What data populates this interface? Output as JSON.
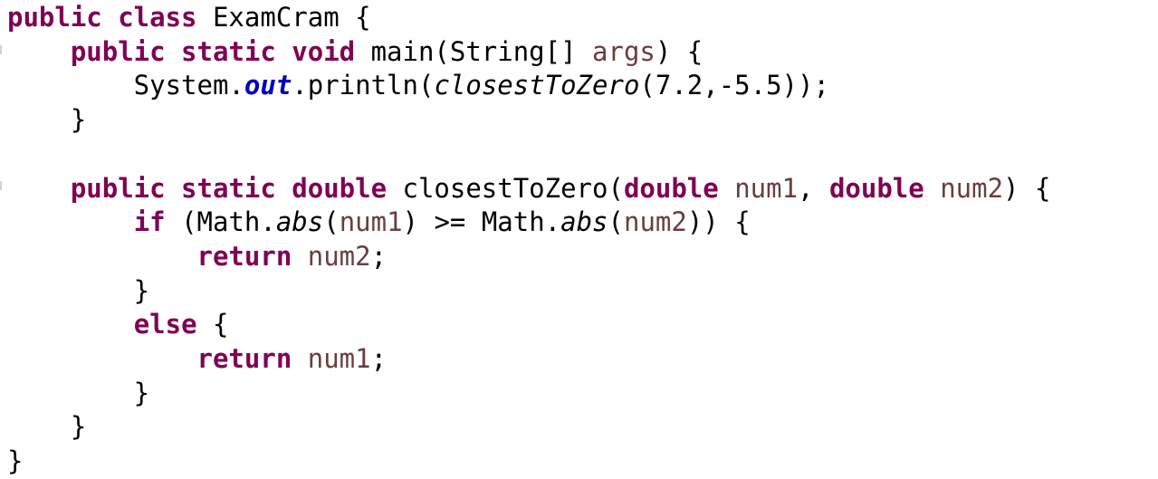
{
  "editor": {
    "lines": [
      {
        "tokens": [
          {
            "t": "public class",
            "k": "kw"
          },
          {
            "t": " ExamCram {",
            "k": "plain"
          }
        ]
      },
      {
        "tokens": [
          {
            "t": "    ",
            "k": "plain"
          },
          {
            "t": "public static void",
            "k": "kw"
          },
          {
            "t": " main(String[] ",
            "k": "plain"
          },
          {
            "t": "args",
            "k": "var"
          },
          {
            "t": ") {",
            "k": "plain"
          }
        ]
      },
      {
        "tokens": [
          {
            "t": "        System.",
            "k": "plain"
          },
          {
            "t": "out",
            "k": "fld"
          },
          {
            "t": ".println(",
            "k": "plain"
          },
          {
            "t": "closestToZero",
            "k": "stc"
          },
          {
            "t": "(7.2,-5.5));",
            "k": "plain"
          }
        ]
      },
      {
        "tokens": [
          {
            "t": "    }",
            "k": "plain"
          }
        ]
      },
      {
        "tokens": []
      },
      {
        "tokens": [
          {
            "t": "    ",
            "k": "plain"
          },
          {
            "t": "public static double",
            "k": "kw"
          },
          {
            "t": " closestToZero(",
            "k": "plain"
          },
          {
            "t": "double",
            "k": "kw"
          },
          {
            "t": " ",
            "k": "plain"
          },
          {
            "t": "num1",
            "k": "var"
          },
          {
            "t": ", ",
            "k": "plain"
          },
          {
            "t": "double",
            "k": "kw"
          },
          {
            "t": " ",
            "k": "plain"
          },
          {
            "t": "num2",
            "k": "var"
          },
          {
            "t": ") {",
            "k": "plain"
          }
        ]
      },
      {
        "tokens": [
          {
            "t": "        ",
            "k": "plain"
          },
          {
            "t": "if",
            "k": "kw"
          },
          {
            "t": " (Math.",
            "k": "plain"
          },
          {
            "t": "abs",
            "k": "stc"
          },
          {
            "t": "(",
            "k": "plain"
          },
          {
            "t": "num1",
            "k": "var"
          },
          {
            "t": ") >= Math.",
            "k": "plain"
          },
          {
            "t": "abs",
            "k": "stc"
          },
          {
            "t": "(",
            "k": "plain"
          },
          {
            "t": "num2",
            "k": "var"
          },
          {
            "t": ")) {",
            "k": "plain"
          }
        ]
      },
      {
        "tokens": [
          {
            "t": "            ",
            "k": "plain"
          },
          {
            "t": "return",
            "k": "kw"
          },
          {
            "t": " ",
            "k": "plain"
          },
          {
            "t": "num2",
            "k": "var"
          },
          {
            "t": ";",
            "k": "plain"
          }
        ]
      },
      {
        "tokens": [
          {
            "t": "        }",
            "k": "plain"
          }
        ]
      },
      {
        "tokens": [
          {
            "t": "        ",
            "k": "plain"
          },
          {
            "t": "else",
            "k": "kw"
          },
          {
            "t": " {",
            "k": "plain"
          }
        ]
      },
      {
        "tokens": [
          {
            "t": "            ",
            "k": "plain"
          },
          {
            "t": "return",
            "k": "kw"
          },
          {
            "t": " ",
            "k": "plain"
          },
          {
            "t": "num1",
            "k": "var"
          },
          {
            "t": ";",
            "k": "plain"
          }
        ]
      },
      {
        "tokens": [
          {
            "t": "        }",
            "k": "plain"
          }
        ]
      },
      {
        "tokens": [
          {
            "t": "    }",
            "k": "plain"
          }
        ]
      },
      {
        "tokens": [
          {
            "t": "}",
            "k": "plain"
          }
        ]
      }
    ],
    "colors": {
      "keyword": "#7f0055",
      "variable": "#6a3e3e",
      "static_field": "#0000c0",
      "text": "#000000",
      "background": "#ffffff"
    }
  }
}
